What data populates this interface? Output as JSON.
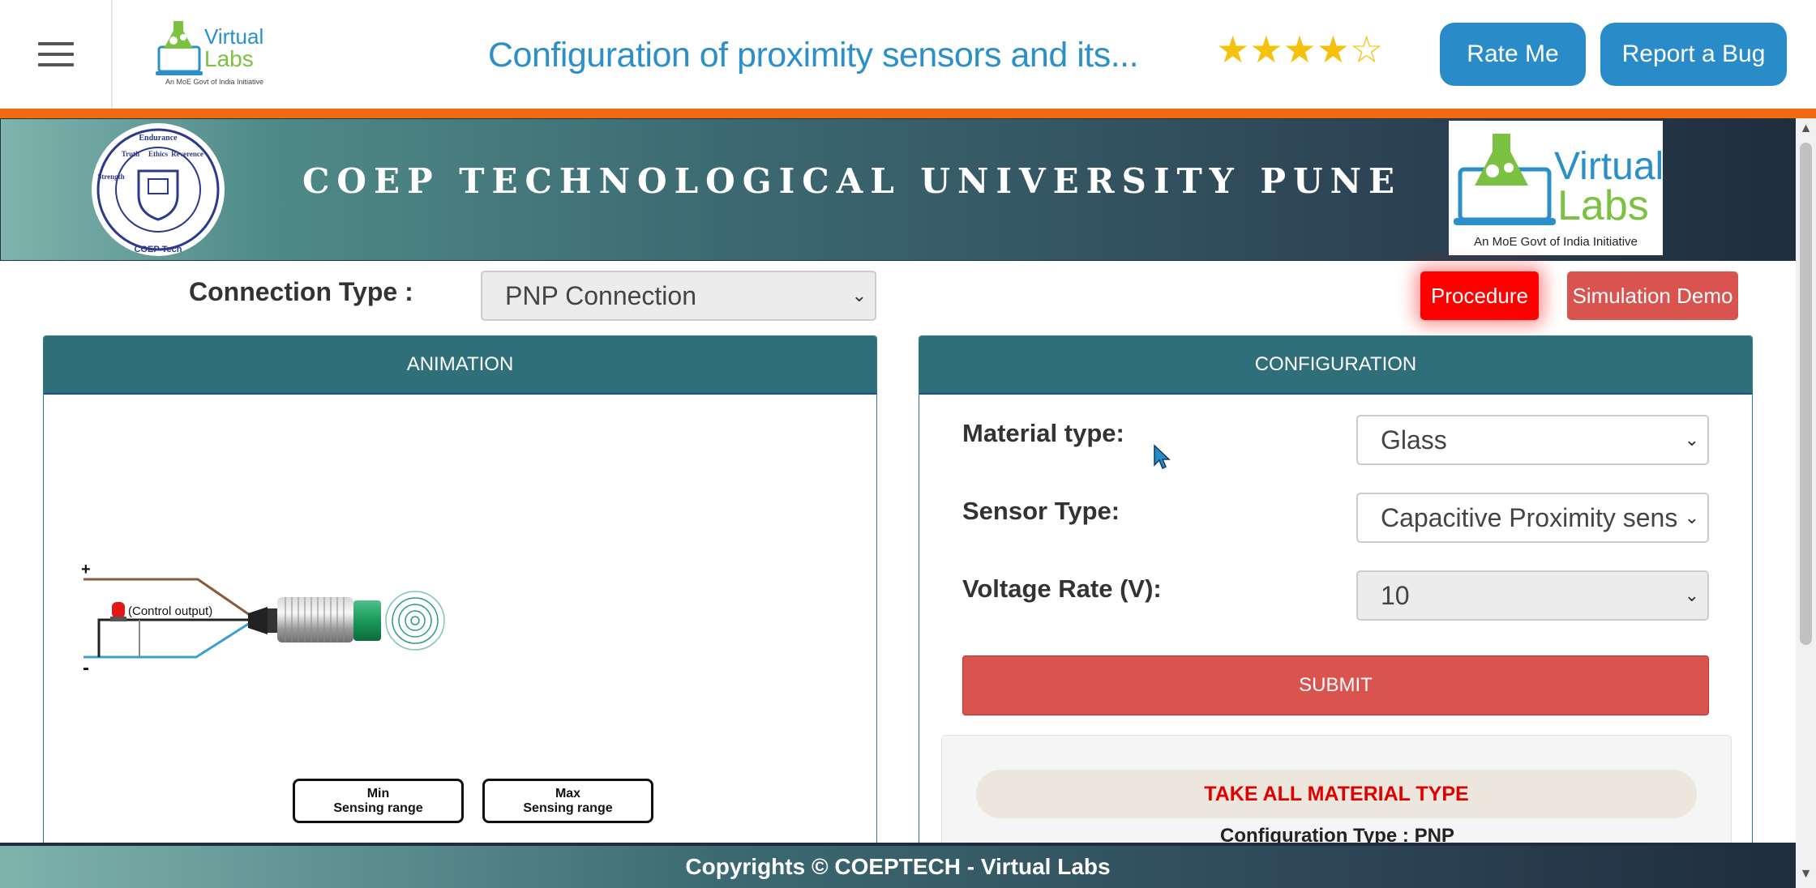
{
  "topbar": {
    "title": "Configuration of proximity sensors and its...",
    "rating": {
      "value": 4,
      "max": 5,
      "star_color": "#f4c20d"
    },
    "rate_me_label": "Rate Me",
    "report_bug_label": "Report a Bug",
    "logo_text_top": "Virtual",
    "logo_text_bottom": "Labs",
    "logo_tagline": "An MoE Govt of India Initiative"
  },
  "banner": {
    "university_name": "COEP TECHNOLOGICAL UNIVERSITY PUNE",
    "coep_logo_words": [
      "Endurance",
      "Truth",
      "Ethics",
      "Reverence",
      "Strength"
    ],
    "coep_logo_caption": "COEP Tech",
    "vl_logo_top": "Virtual",
    "vl_logo_bottom": "Labs",
    "vl_logo_tagline": "An MoE Govt of India Initiative"
  },
  "connection": {
    "label": "Connection Type :",
    "selected": "PNP Connection"
  },
  "buttons": {
    "procedure": "Procedure",
    "simulation_demo": "Simulation Demo"
  },
  "animation_panel": {
    "title": "ANIMATION",
    "plus_label": "+",
    "minus_label": "-",
    "control_output_label": "(Control output)",
    "min_range_line1": "Min",
    "min_range_line2": "Sensing range",
    "max_range_line1": "Max",
    "max_range_line2": "Sensing range"
  },
  "config_panel": {
    "title": "CONFIGURATION",
    "material_label": "Material type:",
    "material_selected": "Glass",
    "sensor_label": "Sensor Type:",
    "sensor_selected": "Capacitive Proximity sens",
    "voltage_label": "Voltage Rate (V):",
    "voltage_selected": "10",
    "submit_label": "SUBMIT",
    "notice": "TAKE ALL MATERIAL TYPE",
    "configuration_type": "Configuration Type : PNP"
  },
  "footer": {
    "text": "Copyrights © COEPTECH - Virtual Labs"
  },
  "colors": {
    "accent_blue": "#2a8bc9",
    "orange_bar": "#f26a10",
    "panel_header": "#2f6f7a",
    "submit_red": "#d9534f",
    "procedure_red": "#ff0000"
  }
}
